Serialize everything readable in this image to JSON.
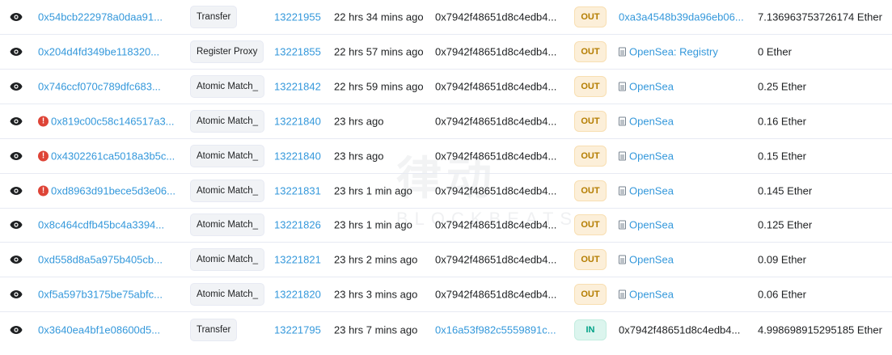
{
  "watermark": {
    "cn": "律动",
    "en": "BLOCKBEATS"
  },
  "rows": [
    {
      "hash": "0x54bcb222978a0daa91...",
      "error": false,
      "method": "Transfer",
      "block": "13221955",
      "age": "22 hrs 34 mins ago",
      "from": "0x7942f48651d8c4edb4...",
      "from_link": false,
      "direction": "OUT",
      "to": "0xa3a4548b39da96eb06...",
      "to_named": false,
      "to_link": true,
      "value": "7.136963753726174 Ether"
    },
    {
      "hash": "0x204d4fd349be118320...",
      "error": false,
      "method": "Register Proxy",
      "block": "13221855",
      "age": "22 hrs 57 mins ago",
      "from": "0x7942f48651d8c4edb4...",
      "from_link": false,
      "direction": "OUT",
      "to": "OpenSea: Registry",
      "to_named": true,
      "to_link": true,
      "value": "0 Ether"
    },
    {
      "hash": "0x746ccf070c789dfc683...",
      "error": false,
      "method": "Atomic Match_",
      "block": "13221842",
      "age": "22 hrs 59 mins ago",
      "from": "0x7942f48651d8c4edb4...",
      "from_link": false,
      "direction": "OUT",
      "to": "OpenSea",
      "to_named": true,
      "to_link": true,
      "value": "0.25 Ether"
    },
    {
      "hash": "0x819c00c58c146517a3...",
      "error": true,
      "method": "Atomic Match_",
      "block": "13221840",
      "age": "23 hrs ago",
      "from": "0x7942f48651d8c4edb4...",
      "from_link": false,
      "direction": "OUT",
      "to": "OpenSea",
      "to_named": true,
      "to_link": true,
      "value": "0.16 Ether"
    },
    {
      "hash": "0x4302261ca5018a3b5c...",
      "error": true,
      "method": "Atomic Match_",
      "block": "13221840",
      "age": "23 hrs ago",
      "from": "0x7942f48651d8c4edb4...",
      "from_link": false,
      "direction": "OUT",
      "to": "OpenSea",
      "to_named": true,
      "to_link": true,
      "value": "0.15 Ether"
    },
    {
      "hash": "0xd8963d91bece5d3e06...",
      "error": true,
      "method": "Atomic Match_",
      "block": "13221831",
      "age": "23 hrs 1 min ago",
      "from": "0x7942f48651d8c4edb4...",
      "from_link": false,
      "direction": "OUT",
      "to": "OpenSea",
      "to_named": true,
      "to_link": true,
      "value": "0.145 Ether"
    },
    {
      "hash": "0x8c464cdfb45bc4a3394...",
      "error": false,
      "method": "Atomic Match_",
      "block": "13221826",
      "age": "23 hrs 1 min ago",
      "from": "0x7942f48651d8c4edb4...",
      "from_link": false,
      "direction": "OUT",
      "to": "OpenSea",
      "to_named": true,
      "to_link": true,
      "value": "0.125 Ether"
    },
    {
      "hash": "0xd558d8a5a975b405cb...",
      "error": false,
      "method": "Atomic Match_",
      "block": "13221821",
      "age": "23 hrs 2 mins ago",
      "from": "0x7942f48651d8c4edb4...",
      "from_link": false,
      "direction": "OUT",
      "to": "OpenSea",
      "to_named": true,
      "to_link": true,
      "value": "0.09 Ether"
    },
    {
      "hash": "0xf5a597b3175be75abfc...",
      "error": false,
      "method": "Atomic Match_",
      "block": "13221820",
      "age": "23 hrs 3 mins ago",
      "from": "0x7942f48651d8c4edb4...",
      "from_link": false,
      "direction": "OUT",
      "to": "OpenSea",
      "to_named": true,
      "to_link": true,
      "value": "0.06 Ether"
    },
    {
      "hash": "0x3640ea4bf1e08600d5...",
      "error": false,
      "method": "Transfer",
      "block": "13221795",
      "age": "23 hrs 7 mins ago",
      "from": "0x16a53f982c5559891c...",
      "from_link": true,
      "direction": "IN",
      "to": "0x7942f48651d8c4edb4...",
      "to_named": false,
      "to_link": false,
      "value": "4.998698915295185 Ether"
    }
  ]
}
